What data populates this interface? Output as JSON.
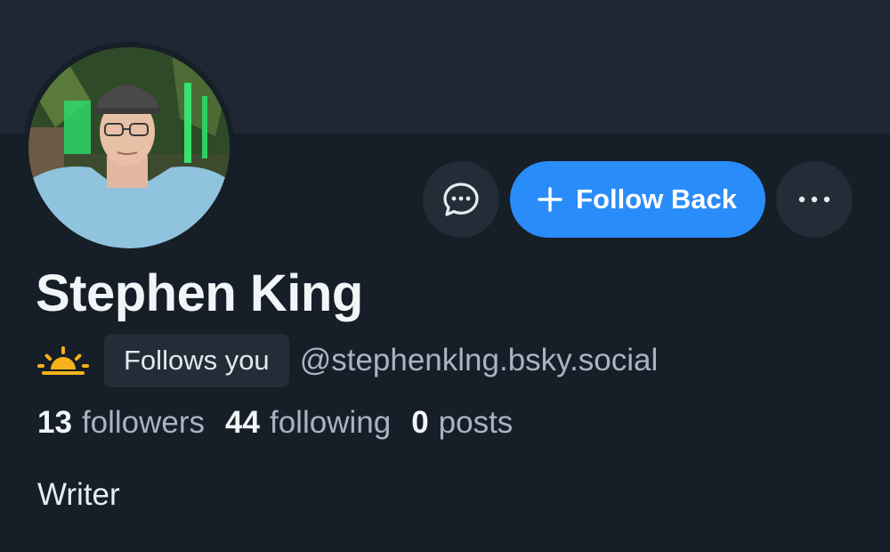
{
  "profile": {
    "display_name": "Stephen King",
    "handle": "@stephenklng.bsky.social",
    "follows_you_label": "Follows you",
    "bio": "Writer",
    "avatar_alt": "Profile photo",
    "status_icon": "sunrise-emoji"
  },
  "actions": {
    "message_icon": "chat-bubble-icon",
    "follow_label": "Follow Back",
    "more_icon": "ellipsis-icon"
  },
  "stats": {
    "followers_count": "13",
    "followers_label": "followers",
    "following_count": "44",
    "following_label": "following",
    "posts_count": "0",
    "posts_label": "posts"
  },
  "colors": {
    "background": "#161e27",
    "banner": "#1e2733",
    "accent": "#2a8cf8",
    "muted_text": "#a7b4c2"
  }
}
